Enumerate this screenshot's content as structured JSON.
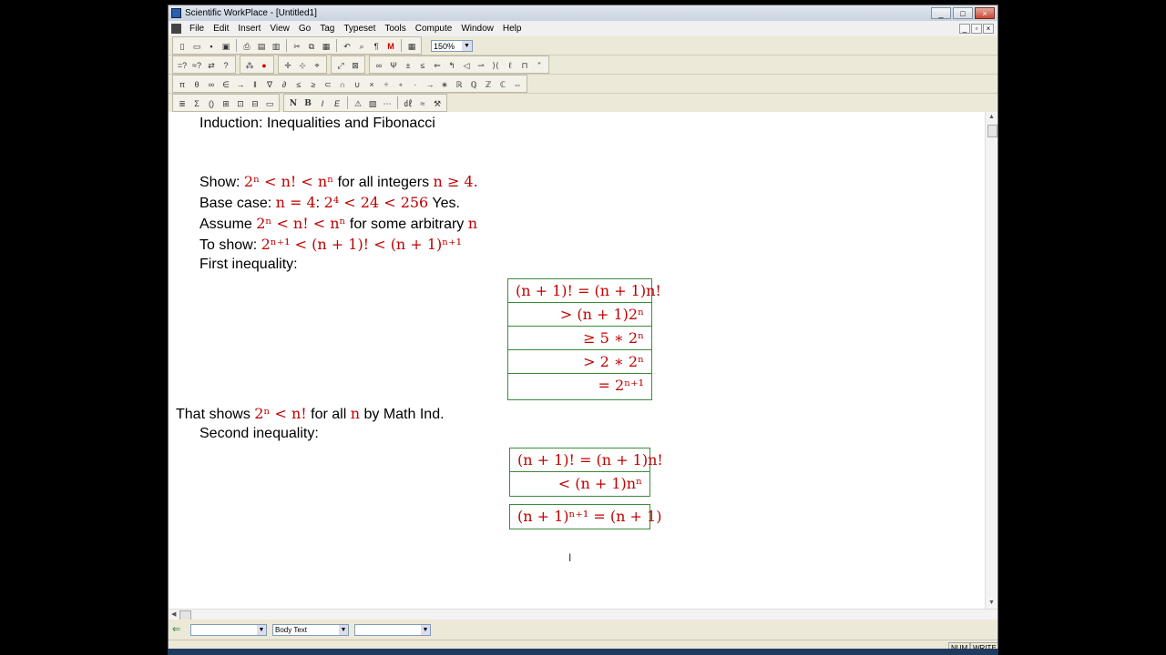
{
  "window": {
    "title": "Scientific WorkPlace - [Untitled1]",
    "buttons": [
      "_",
      "□",
      "×"
    ]
  },
  "menubar": {
    "items": [
      "File",
      "Edit",
      "Insert",
      "View",
      "Go",
      "Tag",
      "Typeset",
      "Tools",
      "Compute",
      "Window",
      "Help"
    ],
    "doc_buttons": [
      "_",
      "▫",
      "×"
    ]
  },
  "toolbar": {
    "zoom": "150%"
  },
  "document": {
    "heading": "Induction: Inequalities and Fibonacci",
    "line_show_prefix": "Show:",
    "line_show_math": "2ⁿ < n! < nⁿ",
    "line_show_mid": "for all integers",
    "line_show_cond": "n ≥ 4.",
    "line_base_prefix": "Base case:",
    "line_base_math1": "n = 4",
    "line_base_colon": ":",
    "line_base_math2": "2⁴ < 24 < 256",
    "line_base_suffix": "Yes.",
    "line_assume_prefix": "Assume",
    "line_assume_math": "2ⁿ < n! < nⁿ",
    "line_assume_suffix": "for some arbitrary",
    "line_assume_var": "n",
    "line_toshow_prefix": "To show:",
    "line_toshow_math": "2ⁿ⁺¹ < (n + 1)! < (n + 1)ⁿ⁺¹",
    "line_first": "First inequality:",
    "box1": [
      "(n + 1)! =  (n + 1)n!",
      "> (n + 1)2ⁿ",
      "≥ 5 ∗ 2ⁿ",
      "> 2 ∗ 2ⁿ",
      "= 2ⁿ⁺¹"
    ],
    "line_that_prefix": "That shows",
    "line_that_math": "2ⁿ < n!",
    "line_that_mid": "for all",
    "line_that_var": "n",
    "line_that_suffix": "by Math Ind.",
    "line_second": "Second inequality:",
    "box2": [
      "(n + 1)! = (n + 1)n!",
      "< (n + 1)nⁿ"
    ],
    "box3": [
      "(n + 1)ⁿ⁺¹ = (n + 1)"
    ]
  },
  "statusrow": {
    "tag_field": "",
    "style_field": "Body Text",
    "extra_field": ""
  },
  "statusbar": {
    "num": "NUM",
    "mode": "WRITE"
  }
}
